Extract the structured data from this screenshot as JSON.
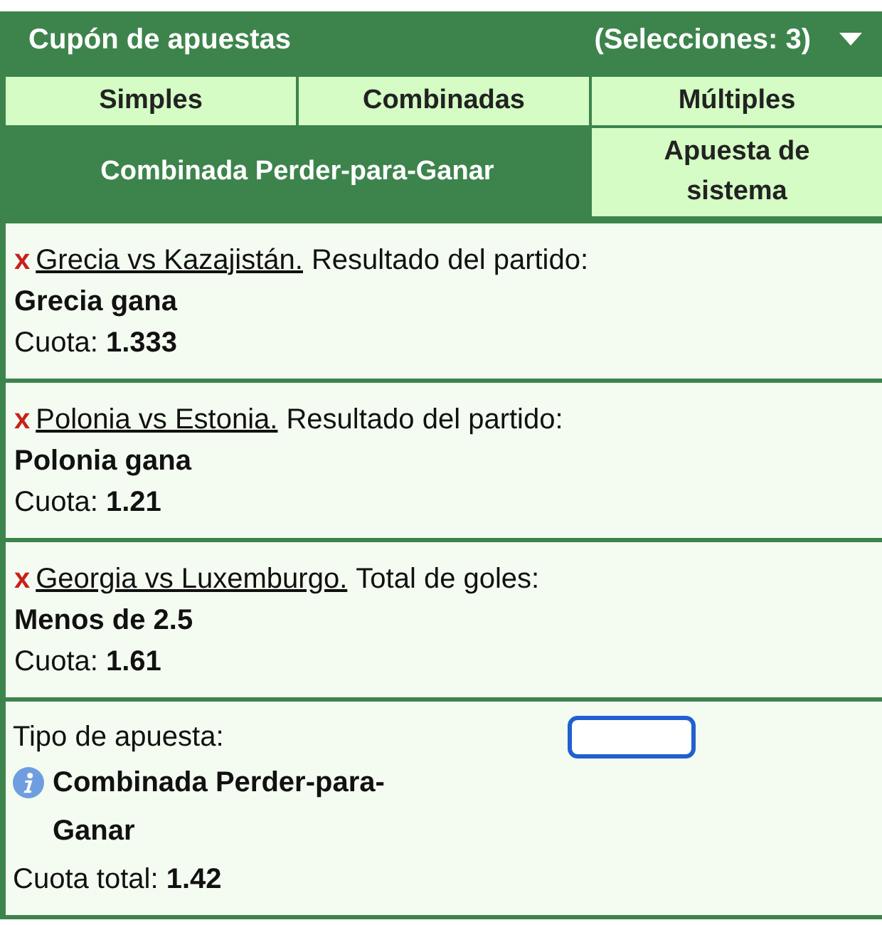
{
  "header": {
    "title": "Cupón de apuestas",
    "count": "(Selecciones: 3)"
  },
  "tabs": [
    {
      "label": "Simples",
      "selected": false
    },
    {
      "label": "Combinadas",
      "selected": false
    },
    {
      "label": "Múltiples",
      "selected": false
    },
    {
      "label": "Combinada Perder-para-Ganar",
      "selected": true
    },
    {
      "label": "Apuesta de sistema",
      "selected": false
    }
  ],
  "selections": [
    {
      "remove": "x",
      "match": "Grecia vs Kazajistán.",
      "market": "Resultado del partido:",
      "pick": "Grecia gana",
      "odds_label": "Cuota:",
      "odds": "1.333"
    },
    {
      "remove": "x",
      "match": "Polonia vs Estonia.",
      "market": "Resultado del partido:",
      "pick": "Polonia gana",
      "odds_label": "Cuota:",
      "odds": "1.21"
    },
    {
      "remove": "x",
      "match": "Georgia vs Luxemburgo.",
      "market": "Total de goles:",
      "pick": "Menos de 2.5",
      "odds_label": "Cuota:",
      "odds": "1.61"
    }
  ],
  "bet_type": {
    "label": "Tipo de apuesta:",
    "name": "Combinada Perder-para-Ganar",
    "total_label": "Cuota total:",
    "total": "1.42"
  }
}
